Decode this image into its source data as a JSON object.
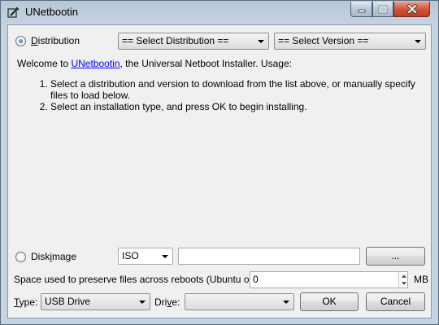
{
  "window": {
    "title": "UNetbootin",
    "controls": {
      "minimize": "minimize",
      "maximize": "maximize",
      "close": "close"
    }
  },
  "distribution": {
    "radio_label_underline": "D",
    "radio_label_rest": "istribution",
    "selected": true,
    "distro_select": "== Select Distribution ==",
    "version_select": "== Select Version =="
  },
  "info": {
    "welcome_prefix": "Welcome to ",
    "welcome_link": "UNetbootin",
    "welcome_suffix": ", the Universal Netboot Installer. Usage:",
    "steps": [
      "Select a distribution and version to download from the list above, or manually specify files to load below.",
      "Select an installation type, and press OK to begin installing."
    ]
  },
  "diskimage": {
    "label_pre": "Disk",
    "label_underline": "i",
    "label_post": "mage",
    "selected": false,
    "format": "ISO",
    "path": "",
    "browse_label": "..."
  },
  "persistence": {
    "label": "Space used to preserve files across reboots (Ubuntu only):",
    "value": "0",
    "unit": "MB"
  },
  "bottom": {
    "type_label_underline": "T",
    "type_label_rest": "ype:",
    "type_value": "USB Drive",
    "drive_label_pre": "Dri",
    "drive_label_underline": "v",
    "drive_label_post": "e:",
    "drive_value": "",
    "ok_label": "OK",
    "cancel_label": "Cancel"
  }
}
